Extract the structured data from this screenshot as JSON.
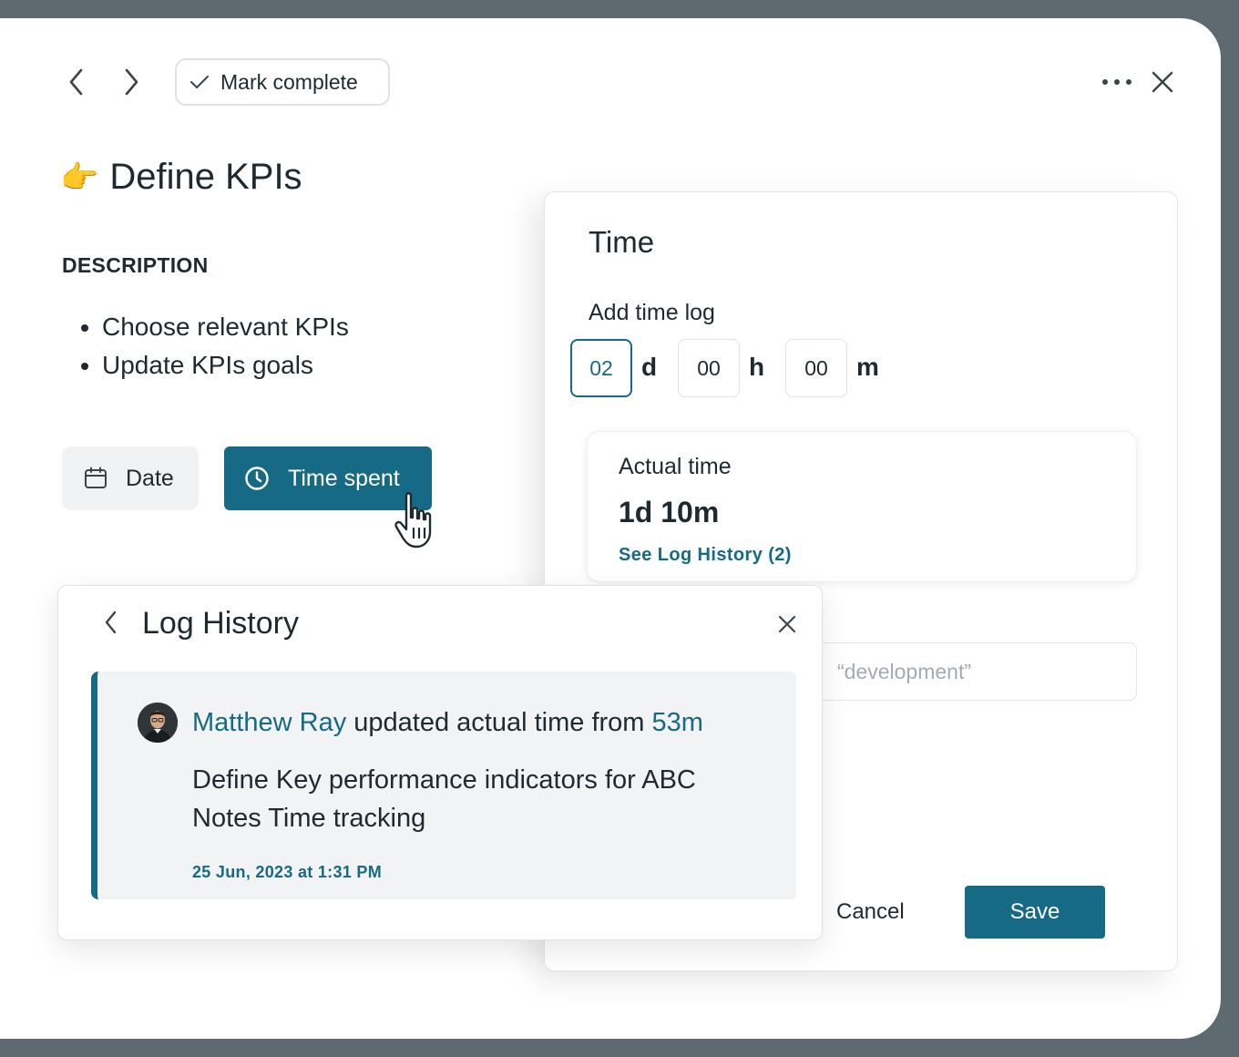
{
  "toolbar": {
    "mark_complete_label": "Mark complete",
    "icons": [
      "chevron-left-icon",
      "chevron-right-icon",
      "check-icon",
      "more-icon",
      "close-icon"
    ]
  },
  "task": {
    "emoji": "👉",
    "title": "Define KPIs",
    "description_label": "DESCRIPTION",
    "description_items": [
      "Choose relevant KPIs",
      "Update KPIs goals"
    ]
  },
  "chips": {
    "date_label": "Date",
    "time_spent_label": "Time spent"
  },
  "time_panel": {
    "title": "Time",
    "add_log_label": "Add time log",
    "days_value": "02",
    "days_unit": "d",
    "hours_value": "00",
    "hours_unit": "h",
    "minutes_value": "00",
    "minutes_unit": "m",
    "actual_label": "Actual time",
    "actual_value": "1d 10m",
    "history_link": "See Log History (2)",
    "tag_placeholder": "“development”",
    "cancel_label": "Cancel",
    "save_label": "Save"
  },
  "log_history": {
    "title": "Log History",
    "entry": {
      "user": "Matthew Ray",
      "action": " updated actual time from ",
      "from_value": "53m",
      "body": "Define Key performance indicators for ABC Notes Time tracking",
      "timestamp": "25 Jun, 2023 at 1:31 PM"
    }
  },
  "colors": {
    "accent": "#176a85",
    "frame": "#5d6b70",
    "card_bg": "#f1f3f5"
  }
}
